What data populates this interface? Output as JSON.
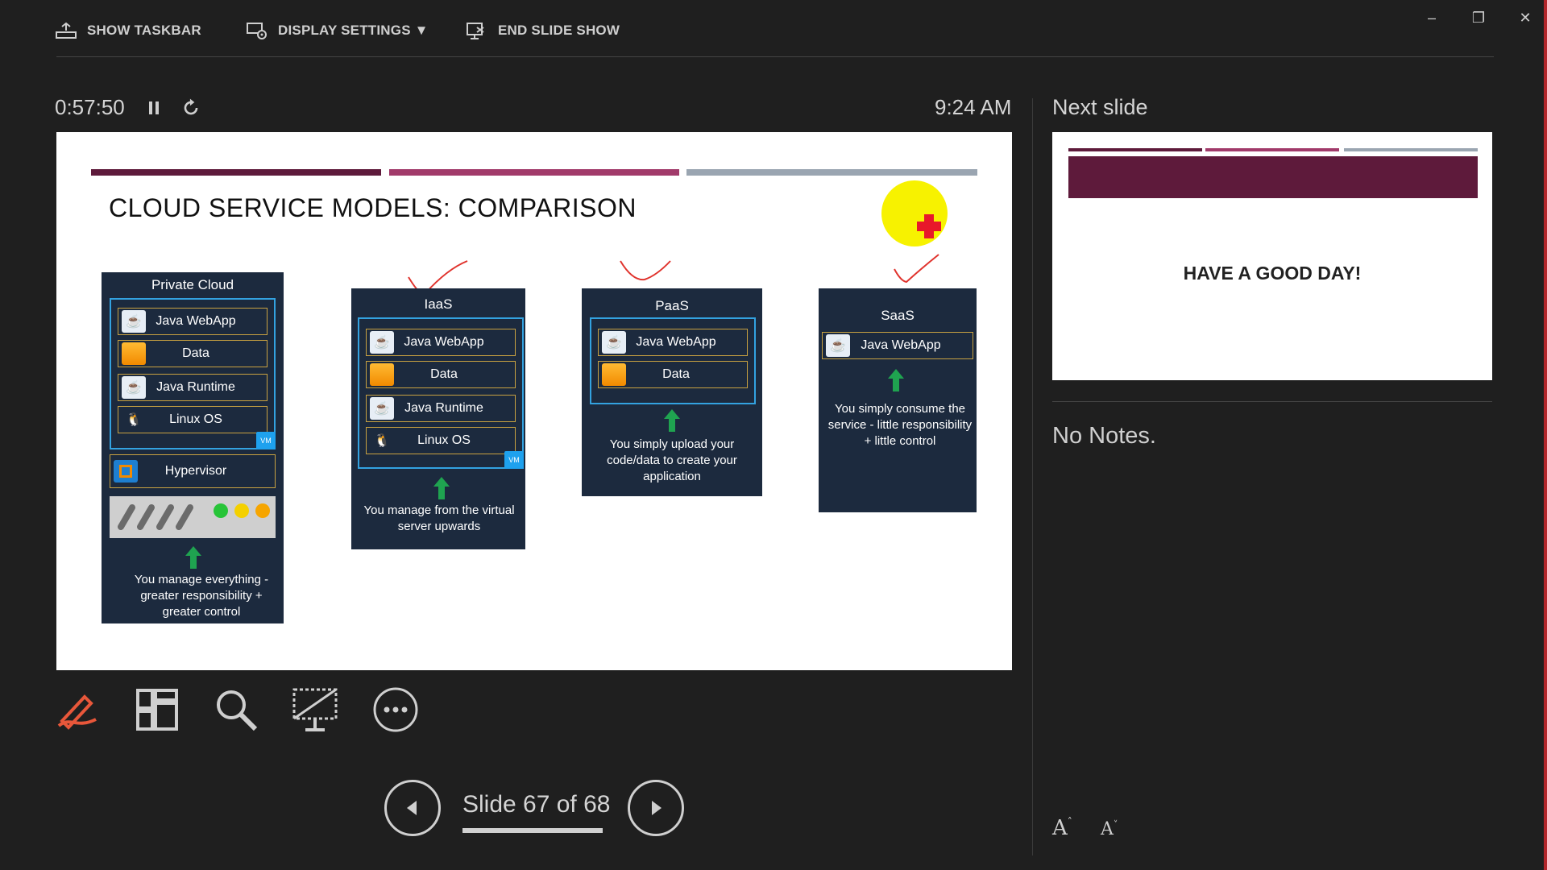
{
  "toolbar": {
    "show_taskbar": "SHOW TASKBAR",
    "display_settings": "DISPLAY SETTINGS ▼",
    "end_slide_show": "END SLIDE SHOW"
  },
  "timer": {
    "elapsed": "0:57:50",
    "clock": "9:24 AM"
  },
  "next_slide": {
    "label": "Next slide",
    "title": "HAVE A GOOD DAY!"
  },
  "notes": {
    "text": "No Notes."
  },
  "navigation": {
    "slide_counter": "Slide 67 of 68"
  },
  "colors": {
    "maroon": "#5e1a3b",
    "pink": "#a13a6a",
    "gray_bar": "#9aa5b1",
    "card_bg": "#1c2a3e",
    "accent_red": "#b2262b"
  },
  "slide": {
    "title": "CLOUD SERVICE MODELS: COMPARISON",
    "private_cloud": {
      "title": "Private Cloud",
      "rows": [
        "Java WebApp",
        "Data",
        "Java Runtime",
        "Linux OS"
      ],
      "vm": "VM",
      "hypervisor": "Hypervisor",
      "desc": "You manage everything - greater responsibility + greater control"
    },
    "iaas": {
      "title": "IaaS",
      "rows": [
        "Java WebApp",
        "Data",
        "Java Runtime",
        "Linux OS"
      ],
      "vm": "VM",
      "desc": "You manage from the virtual server upwards"
    },
    "paas": {
      "title": "PaaS",
      "rows": [
        "Java WebApp",
        "Data"
      ],
      "desc": "You simply upload your code/data to create your application"
    },
    "saas": {
      "title": "SaaS",
      "rows": [
        "Java WebApp"
      ],
      "desc": "You simply consume the service - little responsibility + little control"
    }
  }
}
